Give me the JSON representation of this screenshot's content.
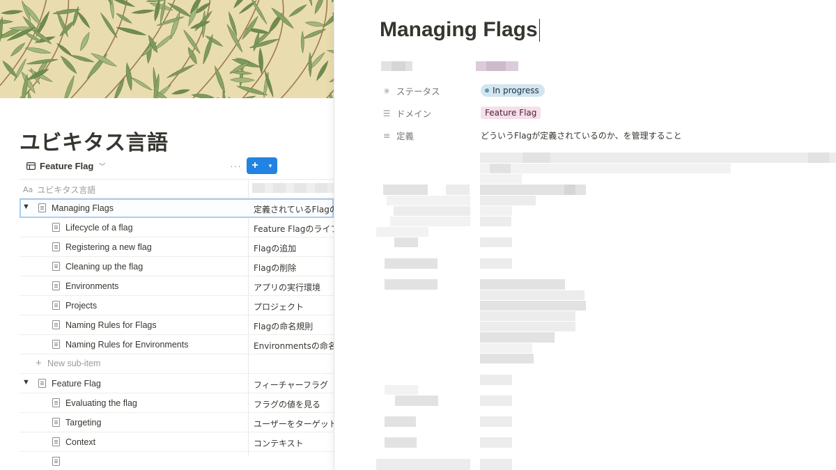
{
  "left_page": {
    "title": "ユビキタス言語",
    "view": {
      "tab_label": "Feature Flag",
      "tab_icon": "table-icon",
      "more": "···",
      "new_button": "+"
    },
    "table": {
      "name_header": "ユビキタス言語",
      "name_header_icon": "text-property-icon",
      "groups": [
        {
          "name": "Managing Flags",
          "definition": "定義されているFlagの",
          "children": [
            {
              "name": "Lifecycle of a flag",
              "definition": "Feature Flagのライフ"
            },
            {
              "name": "Registering a new flag",
              "definition": "Flagの追加"
            },
            {
              "name": "Cleaning up the flag",
              "definition": "Flagの削除"
            },
            {
              "name": "Environments",
              "definition": "アプリの実行環境"
            },
            {
              "name": "Projects",
              "definition": "プロジェクト"
            },
            {
              "name": "Naming Rules for Flags",
              "definition": "Flagの命名規則"
            },
            {
              "name": "Naming Rules for Environments",
              "definition": "Environmentsの命名規"
            }
          ],
          "new_sub_item": "New sub-item"
        },
        {
          "name": "Feature Flag",
          "definition": "フィーチャーフラグ",
          "children": [
            {
              "name": "Evaluating the flag",
              "definition": "フラグの値を見る"
            },
            {
              "name": "Targeting",
              "definition": "ユーザーをターゲット"
            },
            {
              "name": "Context",
              "definition": "コンテキスト"
            }
          ]
        }
      ]
    }
  },
  "peek": {
    "title": "Managing Flags",
    "properties": [
      {
        "label": "ステータス",
        "icon": "status-icon",
        "value": "In progress"
      },
      {
        "label": "ドメイン",
        "icon": "list-icon",
        "value": "Feature Flag"
      },
      {
        "label": "定義",
        "icon": "text-lines-icon",
        "value": "どういうFlagが定義されているのか、を管理すること"
      }
    ]
  },
  "colors": {
    "accent": "#2383e2",
    "status_bg": "#d3e5ef",
    "tag_bg": "#f5e0e9",
    "text": "#37352f"
  }
}
